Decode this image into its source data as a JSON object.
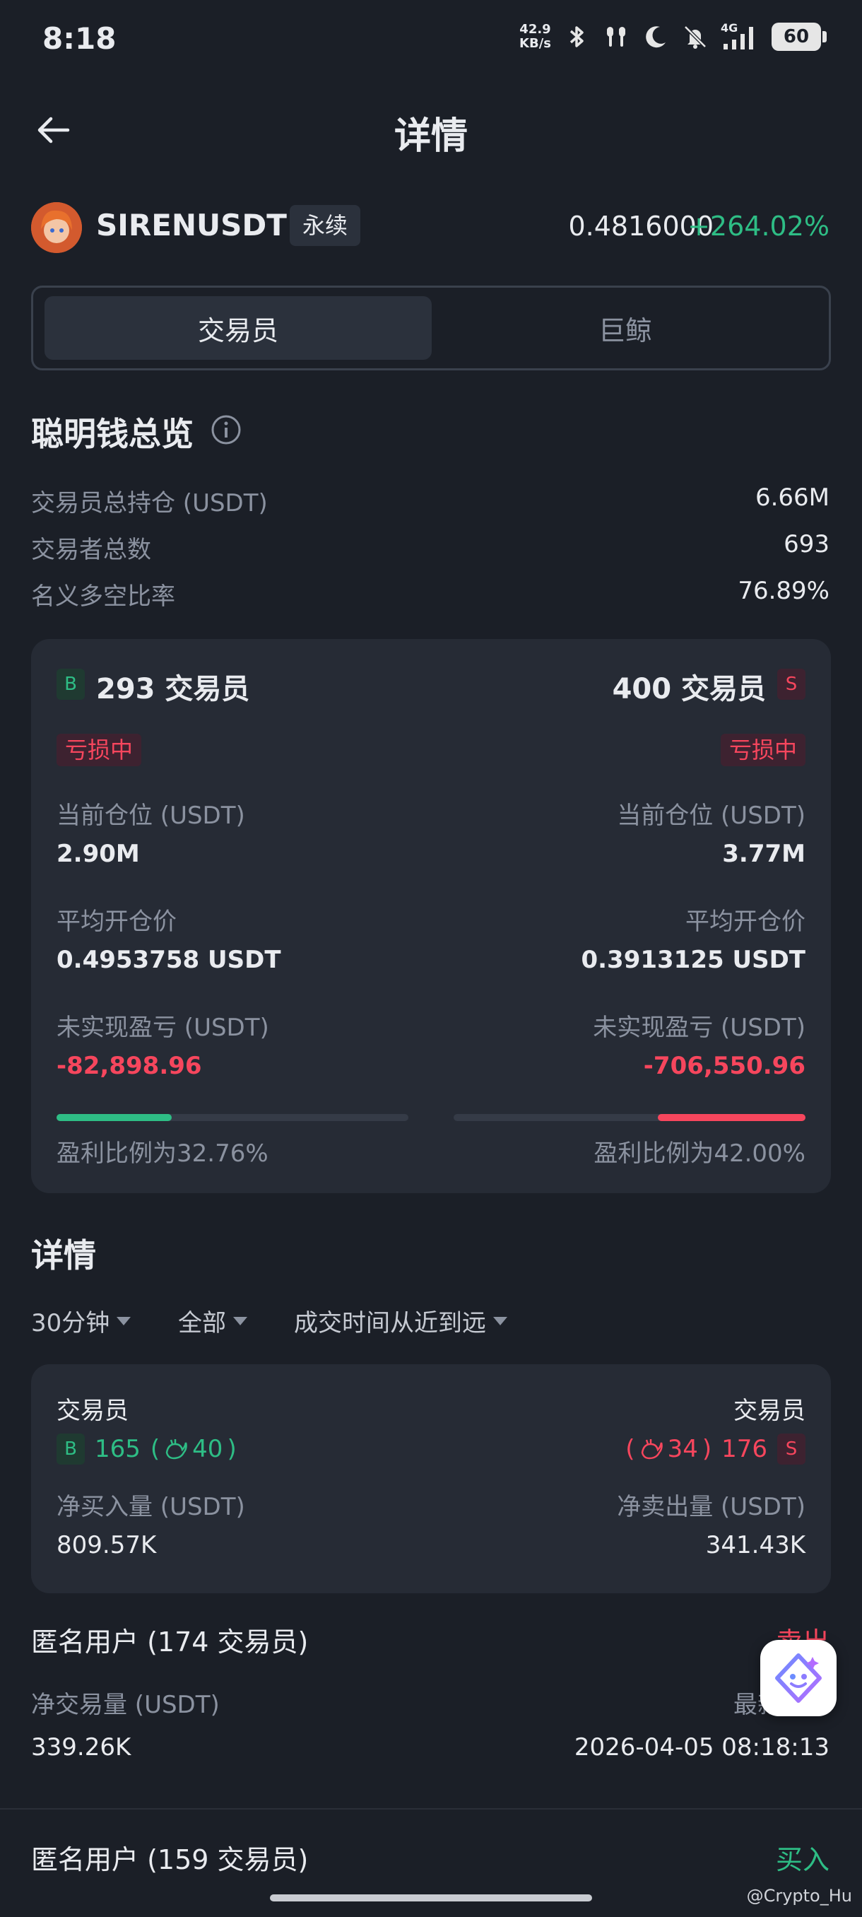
{
  "status_bar": {
    "time": "8:18",
    "net_speed_value": "42.9",
    "net_speed_unit": "KB/s",
    "network": "4G",
    "battery": "60"
  },
  "header": {
    "title": "详情"
  },
  "ticker": {
    "symbol": "SIRENUSDT",
    "badge": "永续",
    "price": "0.4816000",
    "change": "+264.02%"
  },
  "tabs": [
    {
      "label": "交易员",
      "active": true
    },
    {
      "label": "巨鲸",
      "active": false
    }
  ],
  "overview": {
    "title": "聪明钱总览",
    "rows": [
      {
        "label": "交易员总持仓 (USDT)",
        "value": "6.66M"
      },
      {
        "label": "交易者总数",
        "value": "693"
      },
      {
        "label": "名义多空比率",
        "value": "76.89%"
      }
    ]
  },
  "long_short": {
    "long": {
      "badge": "B",
      "count": "293 交易员",
      "status": "亏损中",
      "position_label": "当前仓位 (USDT)",
      "position_value": "2.90M",
      "avg_price_label": "平均开仓价",
      "avg_price_value": "0.4953758 USDT",
      "pnl_label": "未实现盈亏 (USDT)",
      "pnl_value": "-82,898.96",
      "profit_ratio": 0.3276,
      "profit_ratio_text": "盈利比例为32.76%"
    },
    "short": {
      "badge": "S",
      "count": "400 交易员",
      "status": "亏损中",
      "position_label": "当前仓位 (USDT)",
      "position_value": "3.77M",
      "avg_price_label": "平均开仓价",
      "avg_price_value": "0.3913125 USDT",
      "pnl_label": "未实现盈亏 (USDT)",
      "pnl_value": "-706,550.96",
      "profit_ratio": 0.42,
      "profit_ratio_text": "盈利比例为42.00%"
    }
  },
  "details": {
    "title": "详情",
    "filters": [
      "30分钟",
      "全部",
      "成交时间从近到远"
    ],
    "summary": {
      "left_label": "交易员",
      "right_label": "交易员",
      "buy_badge": "B",
      "buy_count": "165",
      "buy_whale": "40",
      "sell_badge": "S",
      "sell_count": "176",
      "sell_whale": "34",
      "net_buy_label": "净买入量 (USDT)",
      "net_buy_value": "809.57K",
      "net_sell_label": "净卖出量 (USDT)",
      "net_sell_value": "341.43K"
    },
    "entries": [
      {
        "title": "匿名用户 (174 交易员)",
        "side": "卖出",
        "volume_label": "净交易量 (USDT)",
        "volume_value": "339.26K",
        "time_label": "最新交易",
        "time_value": "2026-04-05 08:18:13"
      },
      {
        "title": "匿名用户 (159 交易员)",
        "side": "买入"
      }
    ]
  },
  "watermark": "@Crypto_Hu",
  "colors": {
    "up": "#2ebd85",
    "down": "#f6465d",
    "bg": "#1b1f27",
    "card": "#262b35"
  }
}
